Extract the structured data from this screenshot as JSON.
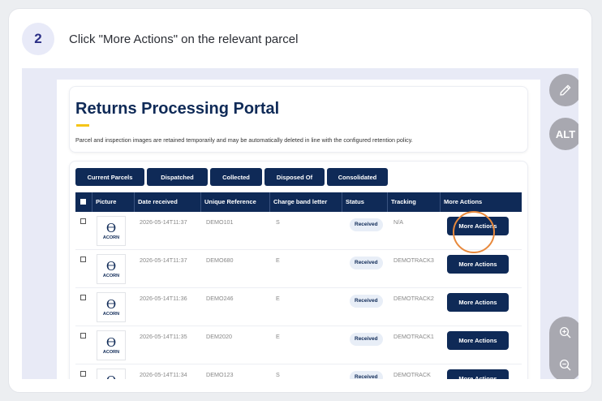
{
  "step": {
    "number": "2",
    "instruction": "Click \"More Actions\" on the relevant parcel"
  },
  "portal": {
    "title": "Returns Processing Portal",
    "note": "Parcel and inspection images are retained temporarily and may be automatically deleted in line with the configured retention policy."
  },
  "tabs": [
    "Current Parcels",
    "Dispatched",
    "Collected",
    "Disposed Of",
    "Consolidated"
  ],
  "columns": [
    "Picture",
    "Date received",
    "Unique Reference",
    "Charge band letter",
    "Status",
    "Tracking",
    "More Actions"
  ],
  "logo_text": "ACORN",
  "rows": [
    {
      "date": "2026-05-14T11:37",
      "ref": "DEMO101",
      "band": "S",
      "status": "Received",
      "tracking": "N/A",
      "action": "More Actions"
    },
    {
      "date": "2026-05-14T11:37",
      "ref": "DEMO680",
      "band": "E",
      "status": "Received",
      "tracking": "DEMOTRACK3",
      "action": "More Actions"
    },
    {
      "date": "2026-05-14T11:36",
      "ref": "DEMO246",
      "band": "E",
      "status": "Received",
      "tracking": "DEMOTRACK2",
      "action": "More Actions"
    },
    {
      "date": "2026-05-14T11:35",
      "ref": "DEM2020",
      "band": "E",
      "status": "Received",
      "tracking": "DEMOTRACK1",
      "action": "More Actions"
    },
    {
      "date": "2026-05-14T11:34",
      "ref": "DEMO123",
      "band": "S",
      "status": "Received",
      "tracking": "DEMOTRACK",
      "action": "More Actions"
    }
  ],
  "controls": {
    "alt_label": "ALT",
    "edit_icon": "pencil-icon",
    "zoom_in_icon": "zoom-in-icon",
    "zoom_out_icon": "zoom-out-icon"
  },
  "colors": {
    "navy": "#0f2a57",
    "accent": "#e8893c",
    "yellow": "#f5c518",
    "badge_bg": "#e8eaf8"
  }
}
